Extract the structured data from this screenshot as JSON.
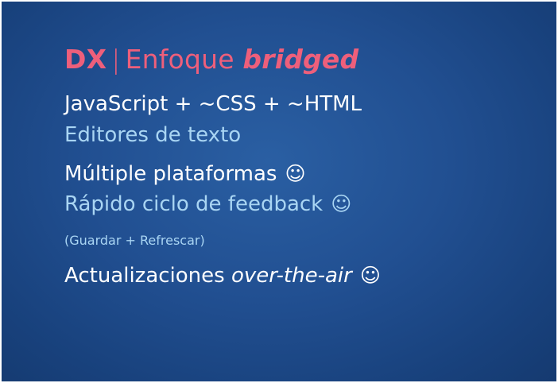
{
  "slide": {
    "title": {
      "prefix": "DX",
      "separator": "|",
      "main": "Enfoque",
      "emphasis": "bridged"
    },
    "lines": [
      {
        "text": "JavaScript + ~CSS + ~HTML"
      },
      {
        "text": "Editores de texto"
      },
      {
        "text": "Múltiple plataformas",
        "icon": "smiley-icon",
        "glyph": "☺"
      },
      {
        "text": "Rápido ciclo de feedback",
        "icon": "smiley-icon",
        "glyph": "☺"
      },
      {
        "text": "(Guardar + Refrescar)"
      },
      {
        "text": "Actualizaciones",
        "emphasis": "over-the-air",
        "icon": "smiley-icon",
        "glyph": "☺"
      }
    ],
    "colors": {
      "title": "#ee5f7b",
      "white_text": "#ffffff",
      "blue_text": "#a9d5f3",
      "background": "#214f91"
    }
  }
}
